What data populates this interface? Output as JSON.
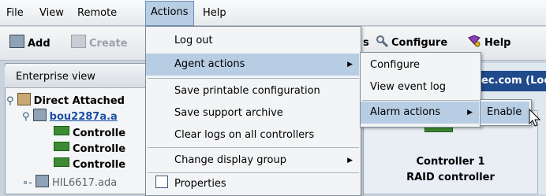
{
  "menubar": {
    "items": [
      {
        "label": "File"
      },
      {
        "label": "View"
      },
      {
        "label": "Remote"
      },
      {
        "label": "Actions"
      },
      {
        "label": "Help"
      }
    ]
  },
  "toolbar": {
    "add": "Add",
    "create": "Create",
    "configure": "Configure",
    "help": "Help",
    "partial_s": "s"
  },
  "panel": {
    "title": "Enterprise view",
    "tree": [
      {
        "label": "Direct Attached"
      },
      {
        "label": "bou2287a.a"
      },
      {
        "label": "Controlle"
      },
      {
        "label": "Controlle"
      },
      {
        "label": "Controlle"
      },
      {
        "label": "HIL6617.ada"
      }
    ]
  },
  "right": {
    "domain": "ec.com (Loc",
    "card_title": "Controller 1",
    "card_sub": "RAID controller"
  },
  "actions_menu": {
    "items": [
      {
        "label": "Log out"
      },
      {
        "label": "Agent actions"
      },
      {
        "label": "Save printable configuration"
      },
      {
        "label": "Save support archive"
      },
      {
        "label": "Clear logs on all controllers"
      },
      {
        "label": "Change display group"
      },
      {
        "label": "Properties"
      }
    ]
  },
  "agent_menu": {
    "items": [
      {
        "label": "Configure"
      },
      {
        "label": "View event log"
      },
      {
        "label": "Alarm actions"
      }
    ]
  },
  "alarm_menu": {
    "items": [
      {
        "label": "Enable"
      }
    ]
  },
  "colors": {
    "menu_highlight": "#b7cde3",
    "domain_bar": "#1f4a8b",
    "controller_green": "#3c8b32"
  }
}
